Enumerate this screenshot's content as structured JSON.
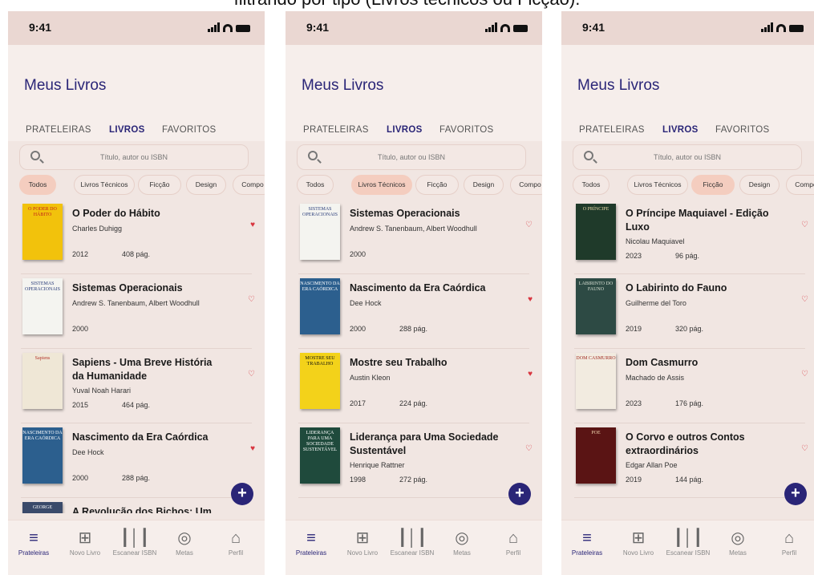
{
  "caption": "filtrando por tipo (Livros técnicos ou Ficção).",
  "status_time": "9:41",
  "app_title": "Meus Livros",
  "tabs": [
    "PRATELEIRAS",
    "LIVROS",
    "FAVORITOS"
  ],
  "active_tab": "LIVROS",
  "search_placeholder": "Título, autor ou ISBN",
  "filters": [
    "Todos",
    "Livros Técnicos",
    "Ficção",
    "Design",
    "Compo"
  ],
  "nav": [
    {
      "label": "Prateleiras",
      "icon": "shelves-icon"
    },
    {
      "label": "Novo Livro",
      "icon": "add-box-icon"
    },
    {
      "label": "Escanear ISBN",
      "icon": "barcode-icon"
    },
    {
      "label": "Metas",
      "icon": "target-icon"
    },
    {
      "label": "Perfil",
      "icon": "person-icon"
    }
  ],
  "colors": {
    "accent": "#2a2577",
    "selected_chip": "#f4cdbf",
    "heart": "#d8353f",
    "background": "#f1e6e2"
  },
  "screens": [
    {
      "selected_filter": "Todos",
      "books": [
        {
          "title": "O Poder do Hábito",
          "author": "Charles Duhigg",
          "year": "2012",
          "pages": "408 pág.",
          "favorite": true,
          "cover_text": "O PODER DO HÁBITO",
          "cover_color": "#f2c20c",
          "cover_ink": "#c0221b"
        },
        {
          "title": "Sistemas Operacionais",
          "author": "Andrew S. Tanenbaum, Albert Woodhull",
          "year": "2000",
          "pages": "",
          "favorite": false,
          "cover_text": "SISTEMAS OPERACIONAIS",
          "cover_color": "#f4f4f0",
          "cover_ink": "#2a3d7a"
        },
        {
          "title": "Sapiens - Uma Breve História da Humanidade",
          "author": "Yuval Noah Harari",
          "year": "2015",
          "pages": "464 pág.",
          "favorite": false,
          "cover_text": "Sapiens",
          "cover_color": "#efe7d6",
          "cover_ink": "#b3342b"
        },
        {
          "title": "Nascimento da Era Caórdica",
          "author": "Dee Hock",
          "year": "2000",
          "pages": "288 pág.",
          "favorite": true,
          "cover_text": "NASCIMENTO DA ERA CAÓRDICA",
          "cover_color": "#2c5f8e",
          "cover_ink": "#ffffff"
        },
        {
          "title": "A Revolução dos Bichos: Um",
          "author": "",
          "year": "",
          "pages": "",
          "favorite": false,
          "cover_text": "GEORGE",
          "cover_color": "#3a4a6a",
          "cover_ink": "#ffffff"
        }
      ]
    },
    {
      "selected_filter": "Livros Técnicos",
      "books": [
        {
          "title": "Sistemas Operacionais",
          "author": "Andrew S. Tanenbaum, Albert Woodhull",
          "year": "2000",
          "pages": "",
          "favorite": false,
          "cover_text": "SISTEMAS OPERACIONAIS",
          "cover_color": "#f4f4f0",
          "cover_ink": "#2a3d7a"
        },
        {
          "title": "Nascimento da Era Caórdica",
          "author": "Dee Hock",
          "year": "2000",
          "pages": "288 pág.",
          "favorite": true,
          "cover_text": "NASCIMENTO DA ERA CAÓRDICA",
          "cover_color": "#2c5f8e",
          "cover_ink": "#ffffff"
        },
        {
          "title": "Mostre seu Trabalho",
          "author": "Austin Kleon",
          "year": "2017",
          "pages": "224 pág.",
          "favorite": true,
          "cover_text": "MOSTRE SEU TRABALHO",
          "cover_color": "#f3d21a",
          "cover_ink": "#111111"
        },
        {
          "title": "Liderança para Uma Sociedade Sustentável",
          "author": "Henrique Rattner",
          "year": "1998",
          "pages": "272 pág.",
          "favorite": false,
          "cover_text": "LIDERANÇA PARA UMA SOCIEDADE SUSTENTÁVEL",
          "cover_color": "#1f4a3c",
          "cover_ink": "#ffffff"
        }
      ]
    },
    {
      "selected_filter": "Ficção",
      "books": [
        {
          "title": "O Príncipe Maquiavel - Edição Luxo",
          "author": "Nicolau Maquiavel",
          "year": "2023",
          "pages": "96 pág.",
          "favorite": false,
          "cover_text": "O PRÍNCIPE",
          "cover_color": "#1f3a2a",
          "cover_ink": "#e8d9a8"
        },
        {
          "title": "O Labirinto do Fauno",
          "author": "Guilherme del Toro",
          "year": "2019",
          "pages": "320 pág.",
          "favorite": false,
          "cover_text": "LABIRINTO DO FAUNO",
          "cover_color": "#2d4a44",
          "cover_ink": "#d9e0d4"
        },
        {
          "title": "Dom Casmurro",
          "author": "Machado de Assis",
          "year": "2023",
          "pages": "176 pág.",
          "favorite": false,
          "cover_text": "DOM CASMURRO",
          "cover_color": "#f2ebe0",
          "cover_ink": "#a02a22"
        },
        {
          "title": "O Corvo e outros Contos extraordinários",
          "author": "Edgar Allan Poe",
          "year": "2019",
          "pages": "144 pág.",
          "favorite": false,
          "cover_text": "POE",
          "cover_color": "#5a1414",
          "cover_ink": "#f2d8b0"
        }
      ]
    }
  ]
}
